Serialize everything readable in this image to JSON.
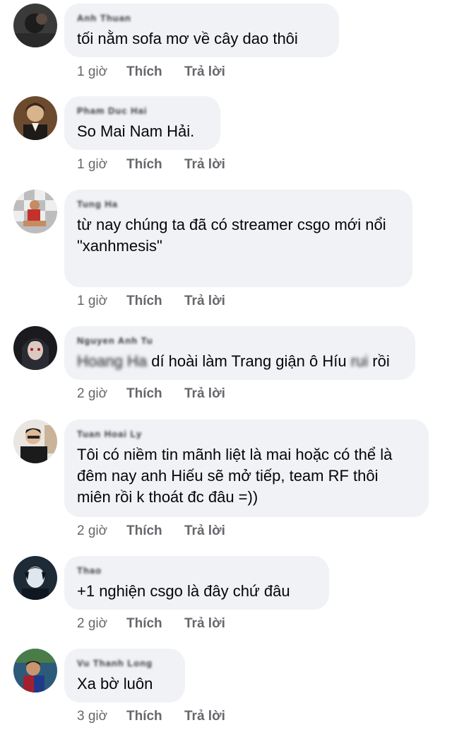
{
  "comments": [
    {
      "name": "Anh Thuan",
      "text": "tối nằm sofa mơ về cây dao thôi",
      "time": "1 giờ",
      "like": "Thích",
      "reply": "Trả lời"
    },
    {
      "name": "Pham Duc Hai",
      "text": "So Mai Nam Hải.",
      "time": "1 giờ",
      "like": "Thích",
      "reply": "Trả lời"
    },
    {
      "name": "Tung Ha",
      "text": "từ nay chúng ta đã có streamer csgo mới nổi\n\"xanhmesis\"",
      "time": "1 giờ",
      "like": "Thích",
      "reply": "Trả lời"
    },
    {
      "name": "Nguyen Anh Tu",
      "text_blur_a": "Hoang Ha",
      "text_a": "dí hoài làm Trang giận ô Híu",
      "text_blur_b": "rui",
      "text_b": "rồi",
      "time": "2 giờ",
      "like": "Thích",
      "reply": "Trả lời"
    },
    {
      "name": "Tuan Hoai Ly",
      "text": "Tôi có niềm tin mãnh liệt là mai hoặc có thể là đêm nay anh Hiếu sẽ mở tiếp, team RF thôi miên rồi k thoát đc đâu =))",
      "time": "2 giờ",
      "like": "Thích",
      "reply": "Trả lời"
    },
    {
      "name": "Thao",
      "text": "+1 nghiện csgo là đây chứ đâu",
      "time": "2 giờ",
      "like": "Thích",
      "reply": "Trả lời"
    },
    {
      "name": "Vu Thanh Long",
      "text": "Xa bờ luôn",
      "time": "3 giờ",
      "like": "Thích",
      "reply": "Trả lời"
    }
  ],
  "colors": {
    "bubble": "#f0f2f5",
    "meta": "#65676b",
    "text": "#050505"
  }
}
